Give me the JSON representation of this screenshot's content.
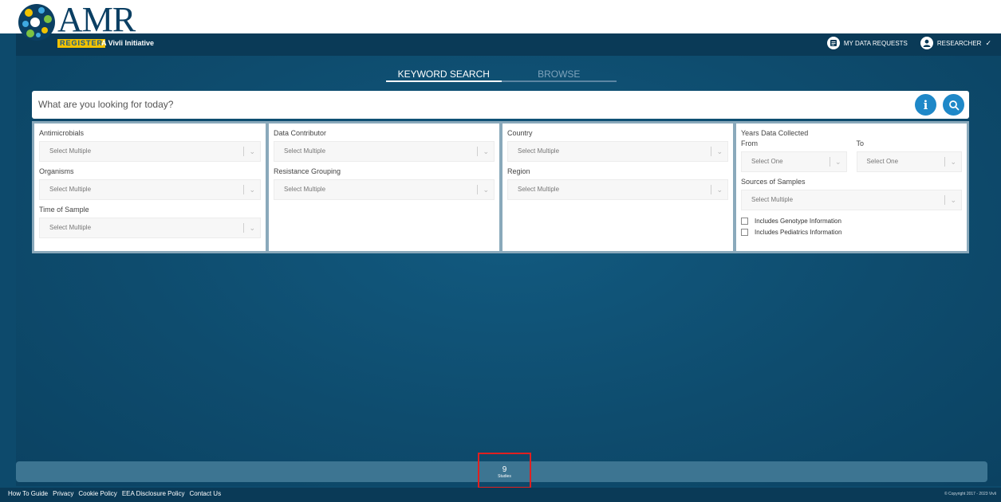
{
  "brand": {
    "name": "AMR",
    "register": "REGISTER",
    "tagline": "A Vivli Initiative"
  },
  "header": {
    "data_requests": "MY DATA REQUESTS",
    "user": "RESEARCHER"
  },
  "tabs": [
    {
      "label": "KEYWORD SEARCH",
      "active": true
    },
    {
      "label": "BROWSE",
      "active": false
    }
  ],
  "search": {
    "placeholder": "What are you looking for today?",
    "info_icon": "i"
  },
  "filters": {
    "antimicrobials": {
      "label": "Antimicrobials",
      "value": "Select Multiple"
    },
    "organisms": {
      "label": "Organisms",
      "value": "Select Multiple"
    },
    "time_of_sample": {
      "label": "Time of Sample",
      "value": "Select Multiple"
    },
    "data_contributor": {
      "label": "Data Contributor",
      "value": "Select Multiple"
    },
    "resistance_grouping": {
      "label": "Resistance Grouping",
      "value": "Select Multiple"
    },
    "country": {
      "label": "Country",
      "value": "Select Multiple"
    },
    "region": {
      "label": "Region",
      "value": "Select Multiple"
    },
    "years": {
      "label": "Years Data Collected",
      "from_label": "From",
      "to_label": "To",
      "from_value": "Select One",
      "to_value": "Select One"
    },
    "sources": {
      "label": "Sources of Samples",
      "value": "Select Multiple"
    },
    "genotype": "Includes Genotype Information",
    "pediatrics": "Includes Pediatrics Information"
  },
  "results": {
    "count": "9",
    "label": "Studies"
  },
  "footer": {
    "links": [
      "How To Guide",
      "Privacy",
      "Cookie Policy",
      "EEA Disclosure Policy",
      "Contact Us"
    ],
    "copyright": "© Copyright 2017 - 2023 Vivli"
  },
  "colors": {
    "background": "#0d4a6c",
    "accent": "#1e88c8",
    "brand_yellow": "#f2c200",
    "highlight": "#e02020"
  }
}
